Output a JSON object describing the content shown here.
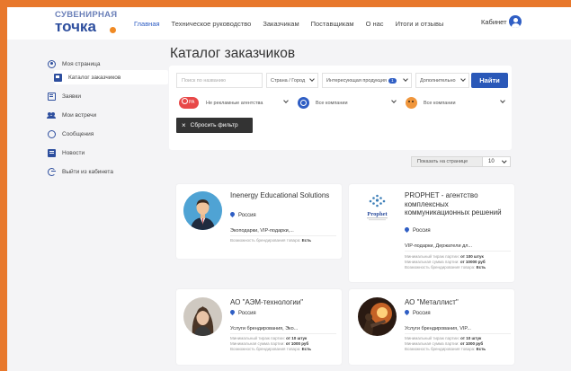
{
  "header": {
    "logo_top": "СУВЕНИРНАЯ",
    "logo_bottom": "точка",
    "nav": [
      "Главная",
      "Техническое руководство",
      "Заказчикам",
      "Поставщикам",
      "О нас",
      "Итоги и отзывы"
    ],
    "cabinet": "Кабинет"
  },
  "sidebar": {
    "items": [
      {
        "label": "Моя страница",
        "icon": "user-icon"
      },
      {
        "label": "Каталог заказчиков",
        "icon": "catalog-icon"
      },
      {
        "label": "Заявки",
        "icon": "list-icon"
      },
      {
        "label": "Мои встречи",
        "icon": "people-icon"
      },
      {
        "label": "Сообщения",
        "icon": "chat-icon"
      },
      {
        "label": "Новости",
        "icon": "news-icon"
      },
      {
        "label": "Выйти из кабинета",
        "icon": "exit-icon"
      }
    ]
  },
  "main": {
    "title": "Каталог заказчиков",
    "filters": {
      "search_placeholder": "Поиск по названию",
      "country": "Страна / Город",
      "products": "Интересующая продукция",
      "products_badge": "1",
      "extra": "Дополнительно",
      "find": "Найти",
      "pa_label": "PA",
      "agencies": "Не рекламные агентства",
      "companies1": "Все компании",
      "companies2": "Все компании",
      "reset": "Сбросить фильтр"
    },
    "per_page_label": "Показать на странице",
    "per_page_value": "10"
  },
  "cards": [
    {
      "title": "Inenergy Educational Solutions",
      "location": "Россия",
      "desc": "Экоподарки, VIP-подарки,...",
      "meta1": "Возможность брендирования товара:",
      "meta1_val": "Есть"
    },
    {
      "title": "PROPHET - агентство комплексных коммуникационных решений",
      "logo_text": "Prophet",
      "location": "Россия",
      "desc": "VIP-подарки, Держатели дл...",
      "min_run": "Минимальный тираж партии:",
      "min_run_val": "от 100 штук",
      "min_sum": "Минимальная сумма партии:",
      "min_sum_val": "от 10000 руб",
      "branding": "Возможность брендирования товара:",
      "branding_val": "Есть"
    },
    {
      "title": "АО \"АЭМ-технологии\"",
      "location": "Россия",
      "desc": "Услуги брендирования, Эко...",
      "min_run": "Минимальный тираж партии:",
      "min_run_val": "от 10 штук",
      "min_sum": "Минимальная сумма партии:",
      "min_sum_val": "от 1000 руб",
      "branding": "Возможность брендирования товара:",
      "branding_val": "Есть"
    },
    {
      "title": "АО \"Металлист\"",
      "location": "Россия",
      "desc": "Услуги брендирования, VIP...",
      "min_run": "Минимальный тираж партии:",
      "min_run_val": "от 10 штук",
      "min_sum": "Минимальная сумма партии:",
      "min_sum_val": "от 1000 руб",
      "branding": "Возможность брендирования товара:",
      "branding_val": "Есть"
    }
  ],
  "colors": {
    "frame": "#e8782c",
    "accent": "#2a58b8",
    "logo_dot": "#f08a24"
  }
}
